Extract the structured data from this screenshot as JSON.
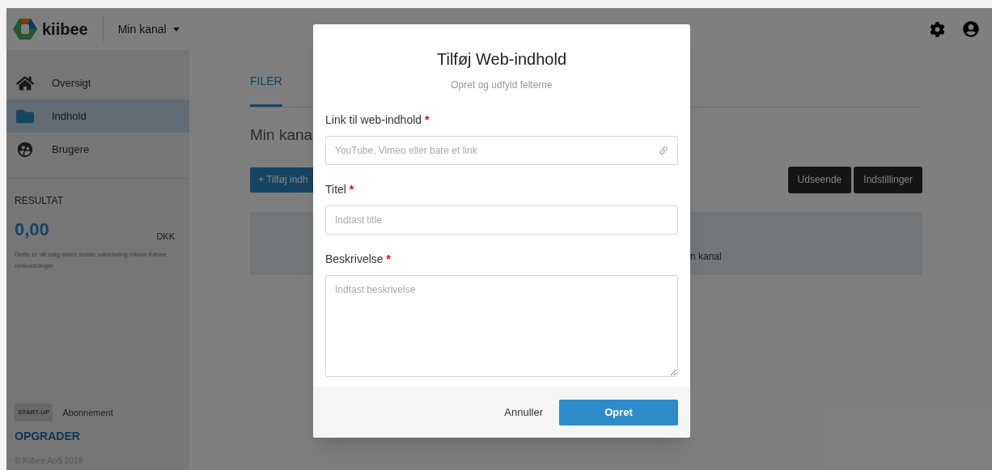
{
  "header": {
    "logo_text": "kiibee",
    "channel_menu": "Min kanal"
  },
  "sidebar": {
    "items": [
      {
        "label": "Oversigt",
        "selected": false
      },
      {
        "label": "Indhold",
        "selected": true
      },
      {
        "label": "Brugere",
        "selected": false
      }
    ],
    "result": {
      "label": "RESULTAT",
      "amount": "0,00",
      "currency": "DKK",
      "note": "Dette er dit salg siden sidste udbetaling minus Kiibee omkostninger"
    },
    "plan": {
      "badge": "START-UP",
      "label": "Abonnement",
      "upgrade": "OPGRADER"
    },
    "copyright": "© Kiibee ApS 2019"
  },
  "main": {
    "tabs": [
      {
        "label": "FILER",
        "selected": true
      }
    ],
    "heading": "Min kana",
    "add_button": "+ Tilføj indh",
    "buttons": [
      "Udseende",
      "Indstillinger"
    ],
    "info_text": "n kanal"
  },
  "modal": {
    "title": "Tilføj Web-indhold",
    "subtitle": "Opret og udfyld felterne",
    "fields": [
      {
        "kind": "url",
        "label": "Link til web-indhold",
        "required_mark": "*",
        "placeholder": "YouTube, Vimeo eller bare et link"
      },
      {
        "kind": "text",
        "label": "Titel",
        "required_mark": "*",
        "placeholder": "Indtast title"
      },
      {
        "kind": "textarea",
        "label": "Beskrivelse",
        "required_mark": "*",
        "placeholder": "Indtast beskrivelse"
      }
    ],
    "cancel": "Annuller",
    "submit": "Opret"
  }
}
